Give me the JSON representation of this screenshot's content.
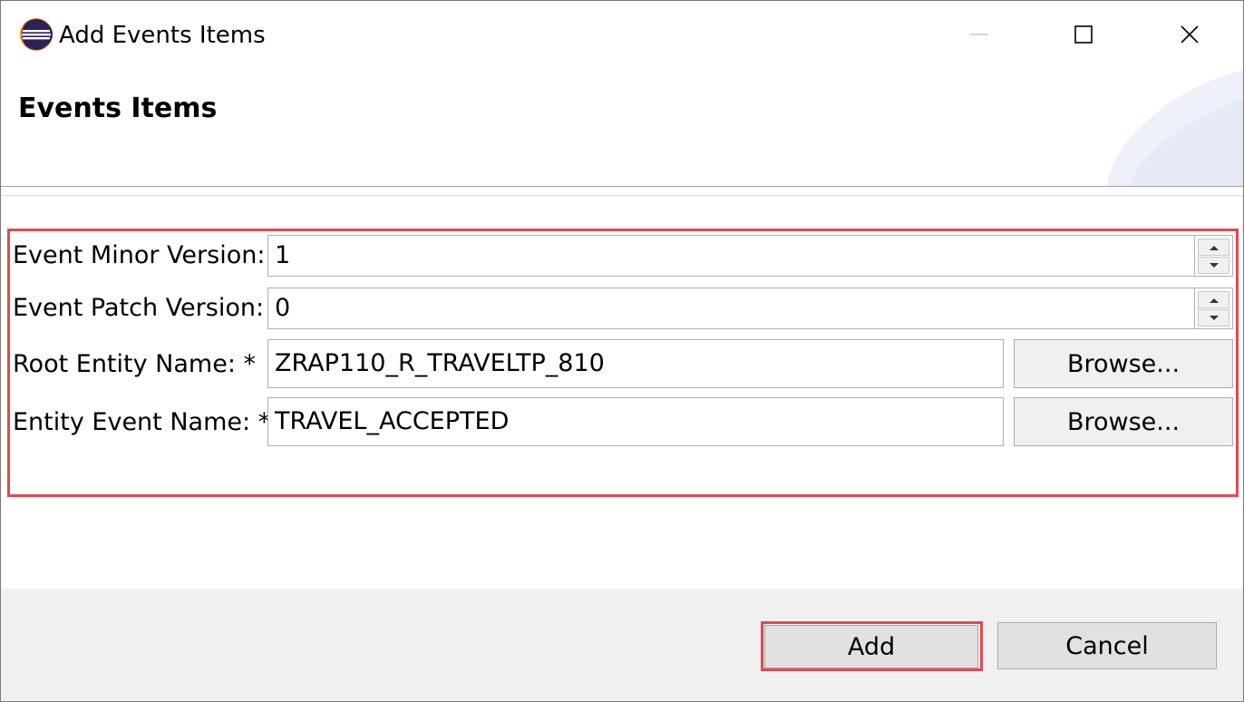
{
  "window": {
    "title": "Add Events Items",
    "controls": {
      "minimize": "minimize-icon",
      "maximize": "maximize-icon",
      "close": "close-icon"
    }
  },
  "header": {
    "title": "Events Items"
  },
  "form": {
    "minor_version": {
      "label": "Event Minor Version:",
      "value": "1"
    },
    "patch_version": {
      "label": "Event Patch Version:",
      "value": "0"
    },
    "root_entity": {
      "label": "Root Entity Name: *",
      "value": "ZRAP110_R_TRAVELTP_810",
      "browse_label": "Browse..."
    },
    "entity_event": {
      "label": "Entity Event Name: *",
      "value": "TRAVEL_ACCEPTED",
      "browse_label": "Browse..."
    }
  },
  "footer": {
    "add_label": "Add",
    "cancel_label": "Cancel"
  },
  "colors": {
    "highlight": "#e3484f",
    "footer_bg": "#f0f0f0",
    "button_bg": "#e1e1e1"
  }
}
